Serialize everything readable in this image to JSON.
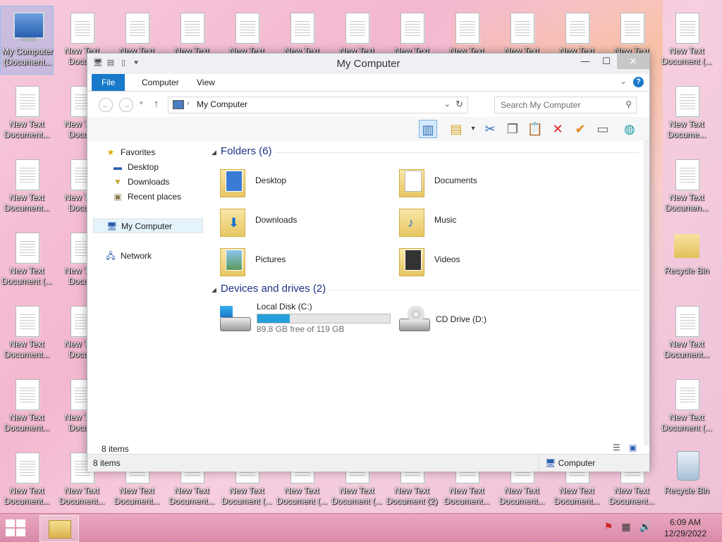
{
  "desktop": {
    "icons": [
      {
        "label": "My Computer",
        "label2": "(Document..."
      },
      {
        "label": "New Text",
        "label2": "Docum"
      },
      {
        "label": "New Text",
        "label2": ""
      },
      {
        "label": "New Text",
        "label2": ""
      },
      {
        "label": "New Text",
        "label2": ""
      },
      {
        "label": "New Text",
        "label2": ""
      },
      {
        "label": "New Text",
        "label2": ""
      },
      {
        "label": "New Text",
        "label2": ""
      },
      {
        "label": "New Text",
        "label2": ""
      },
      {
        "label": "New Text",
        "label2": ""
      },
      {
        "label": "New Text",
        "label2": ""
      },
      {
        "label": "New Text",
        "label2": ""
      },
      {
        "label": "New Text",
        "label2": "Document (..."
      },
      {
        "label": "New Text",
        "label2": "Document..."
      },
      {
        "label": "New Text",
        "label2": "Docum"
      },
      {
        "label": "New Text",
        "label2": "Docume..."
      },
      {
        "label": "New Text",
        "label2": "Document..."
      },
      {
        "label": "New Text",
        "label2": "Docum"
      },
      {
        "label": "New Text",
        "label2": "Documen..."
      },
      {
        "label": "New Text",
        "label2": "Document (..."
      },
      {
        "label": "New Text",
        "label2": "Docum"
      },
      {
        "label": "Recycle Bin",
        "label2": ""
      },
      {
        "label": "New Text",
        "label2": "Document..."
      },
      {
        "label": "New Text",
        "label2": "Docum"
      },
      {
        "label": "New Text",
        "label2": "Document..."
      },
      {
        "label": "New Text",
        "label2": "Document..."
      },
      {
        "label": "New Text",
        "label2": "Docum"
      },
      {
        "label": "New Text",
        "label2": "Document (..."
      },
      {
        "label": "New Text",
        "label2": "Document..."
      },
      {
        "label": "New Text",
        "label2": "Document..."
      },
      {
        "label": "New Text",
        "label2": "Document..."
      },
      {
        "label": "New Text",
        "label2": "Document..."
      },
      {
        "label": "New Text",
        "label2": "Document (..."
      },
      {
        "label": "New Text",
        "label2": "Document (..."
      },
      {
        "label": "New Text",
        "label2": "Document (..."
      },
      {
        "label": "New Text",
        "label2": "Document (2)"
      },
      {
        "label": "New Text",
        "label2": "Document..."
      },
      {
        "label": "New Text",
        "label2": "Document..."
      },
      {
        "label": "New Text",
        "label2": "Document..."
      },
      {
        "label": "New Text",
        "label2": "Document..."
      },
      {
        "label": "Recycle Bin",
        "label2": ""
      }
    ]
  },
  "window": {
    "title": "My Computer",
    "controls": {
      "minimize": "—",
      "maximize": "☐",
      "close": "✕"
    },
    "ribbon_tabs": [
      "File",
      "Computer",
      "View"
    ],
    "help": "?",
    "address": {
      "path": "My Computer",
      "separator": "›"
    },
    "search": {
      "placeholder": "Search My Computer"
    },
    "nav": {
      "favorites": "Favorites",
      "fav_items": [
        "Desktop",
        "Downloads",
        "Recent places"
      ],
      "computer": "My Computer",
      "network": "Network"
    },
    "groups": {
      "folders": "Folders (6)",
      "devices": "Devices and drives (2)"
    },
    "folders": [
      "Desktop",
      "Documents",
      "Downloads",
      "Music",
      "Pictures",
      "Videos"
    ],
    "drives": [
      {
        "name": "Local Disk (C:)",
        "free": "89.8 GB free of 119 GB",
        "used_fraction": 0.245
      },
      {
        "name": "CD Drive (D:)"
      }
    ],
    "item_count": "8 items",
    "status": {
      "left": "8 items",
      "right": "Computer"
    }
  },
  "taskbar": {
    "time": "6:09 AM",
    "date": "12/29/2022"
  },
  "colors": {
    "accent": "#1979ca",
    "progress": "#26a0da",
    "group_header": "#1e3287"
  }
}
